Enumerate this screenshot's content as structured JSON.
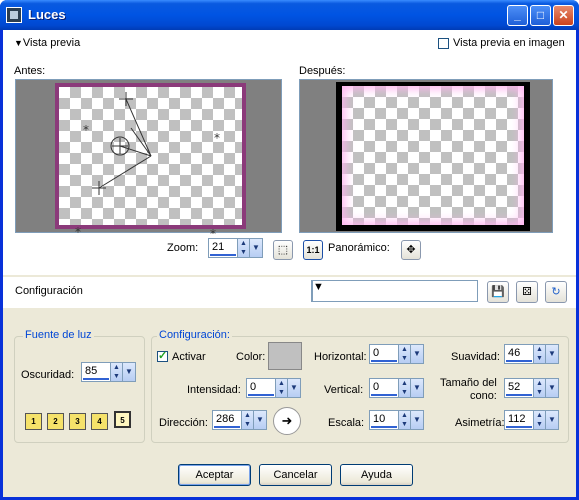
{
  "window": {
    "title": "Luces"
  },
  "preview": {
    "toggle_label": "Vista previa",
    "in_image_label": "Vista previa en imagen",
    "before_label": "Antes:",
    "after_label": "Después:",
    "zoom_label": "Zoom:",
    "zoom_value": "21",
    "ratio_button": "1:1",
    "panoramic_label": "Panorámico:"
  },
  "presets": {
    "label": "Configuración",
    "value": ""
  },
  "light_source": {
    "group_label": "Fuente de luz",
    "darkness_label": "Oscuridad:",
    "darkness_value": "85",
    "lights": [
      "1",
      "2",
      "3",
      "4",
      "5"
    ]
  },
  "settings": {
    "group_label": "Configuración:",
    "activate_label": "Activar",
    "color_label": "Color:",
    "color_value": "#c0c0c0",
    "intensity_label": "Intensidad:",
    "intensity_value": "0",
    "direction_label": "Dirección:",
    "direction_value": "286",
    "horizontal_label": "Horizontal:",
    "horizontal_value": "0",
    "vertical_label": "Vertical:",
    "vertical_value": "0",
    "scale_label": "Escala:",
    "scale_value": "10",
    "softness_label": "Suavidad:",
    "softness_value": "46",
    "cone_label_1": "Tamaño del",
    "cone_label_2": "cono:",
    "cone_value": "52",
    "asymmetry_label": "Asimetría:",
    "asymmetry_value": "112"
  },
  "buttons": {
    "accept": "Aceptar",
    "cancel": "Cancelar",
    "help": "Ayuda"
  }
}
